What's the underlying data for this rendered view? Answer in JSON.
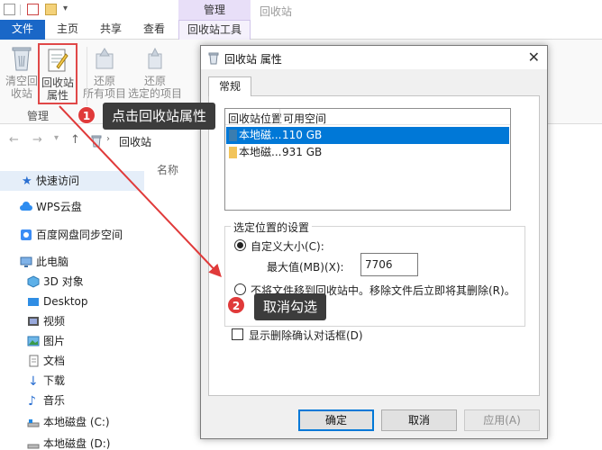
{
  "explorer": {
    "context_tab": "管理",
    "context_title": "回收站",
    "tabs": {
      "file": "文件",
      "home": "主页",
      "share": "共享",
      "view": "查看",
      "tools": "回收站工具"
    },
    "ribbon": {
      "empty": [
        "清空回",
        "收站"
      ],
      "properties": [
        "回收站",
        "属性"
      ],
      "restore_all": [
        "还原",
        "所有项目"
      ],
      "restore_selected": [
        "还原",
        "选定的项目"
      ],
      "group_label": "管理"
    },
    "address": {
      "path": "回收站"
    },
    "column_name": "名称",
    "nav": {
      "quick_access": "快速访问",
      "wps": "WPS云盘",
      "baidu": "百度网盘同步空间",
      "this_pc": "此电脑",
      "objects3d": "3D 对象",
      "desktop": "Desktop",
      "videos": "视频",
      "pictures": "图片",
      "documents": "文档",
      "downloads": "下载",
      "music": "音乐",
      "disk_c": "本地磁盘 (C:)",
      "disk_d": "本地磁盘 (D:)"
    }
  },
  "dialog": {
    "title": "回收站 属性",
    "tab": "常规",
    "list": {
      "headers": {
        "location": "回收站位置",
        "space": "可用空间"
      },
      "rows": [
        {
          "name": "本地磁...",
          "space": "110 GB"
        },
        {
          "name": "本地磁...",
          "space": "931 GB"
        }
      ]
    },
    "settings_legend": "选定位置的设置",
    "custom_size_label": "自定义大小(C):",
    "max_size_label": "最大值(MB)(X):",
    "max_size_value": "7706",
    "no_recycle_label": "不将文件移到回收站中。移除文件后立即将其删除(R)。",
    "confirm_label": "显示删除确认对话框(D)",
    "buttons": {
      "ok": "确定",
      "cancel": "取消",
      "apply": "应用(A)"
    }
  },
  "annotations": {
    "step1": {
      "num": "1",
      "label": "点击回收站属性"
    },
    "step2": {
      "num": "2",
      "label": "取消勾选"
    },
    "accent_color": "#e03a3a"
  }
}
